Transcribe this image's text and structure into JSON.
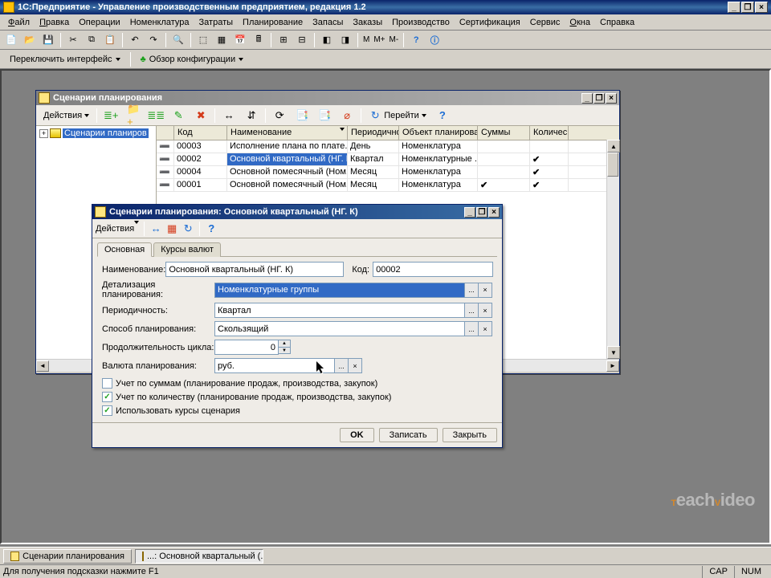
{
  "app": {
    "title": "1С:Предприятие - Управление производственным предприятием, редакция 1.2",
    "menus": [
      "Файл",
      "Правка",
      "Операции",
      "Номенклатура",
      "Затраты",
      "Планирование",
      "Запасы",
      "Заказы",
      "Производство",
      "Сертификация",
      "Сервис",
      "Окна",
      "Справка"
    ],
    "switch_interface": "Переключить интерфейс",
    "config_overview": "Обзор конфигурации"
  },
  "list_window": {
    "title": "Сценарии планирования",
    "actions": "Действия",
    "goto": "Перейти",
    "tree_root": "Сценарии планиров",
    "columns": [
      "",
      "Код",
      "Наименование",
      "Периодично..",
      "Объект планирова..",
      "Суммы",
      "Количес.."
    ],
    "rows": [
      {
        "code": "00003",
        "name": "Исполнение плана по плате..",
        "period": "День",
        "object": "Номенклатура",
        "sum": false,
        "qty": false
      },
      {
        "code": "00002",
        "name": "Основной квартальный (НГ. К)",
        "period": "Квартал",
        "object": "Номенклатурные ..",
        "sum": false,
        "qty": true
      },
      {
        "code": "00004",
        "name": "Основной помесячный (Ном..",
        "period": "Месяц",
        "object": "Номенклатура",
        "sum": false,
        "qty": true
      },
      {
        "code": "00001",
        "name": "Основной помесячный (Ном..",
        "period": "Месяц",
        "object": "Номенклатура",
        "sum": true,
        "qty": true
      }
    ]
  },
  "dialog": {
    "title": "Сценарии планирования: Основной квартальный (НГ. К)",
    "actions": "Действия",
    "tab_main": "Основная",
    "tab_rates": "Курсы валют",
    "fields": {
      "name_label": "Наименование:",
      "name_value": "Основной квартальный (НГ. К)",
      "code_label": "Код:",
      "code_value": "00002",
      "detail_label": "Детализация планирования:",
      "detail_value": "Номенклатурные группы",
      "period_label": "Периодичность:",
      "period_value": "Квартал",
      "method_label": "Способ планирования:",
      "method_value": "Скользящий",
      "cycle_label": "Продолжительность цикла:",
      "cycle_value": "0",
      "currency_label": "Валюта планирования:",
      "currency_value": "руб."
    },
    "checks": {
      "by_sum": "Учет по суммам (планирование продаж, производства, закупок)",
      "by_qty": "Учет по количеству (планирование продаж, производства, закупок)",
      "use_rates": "Использовать курсы сценария"
    },
    "buttons": {
      "ok": "OK",
      "write": "Записать",
      "close": "Закрыть"
    }
  },
  "taskbar": {
    "item1": "Сценарии планирования",
    "item2": "...: Основной квартальный (..."
  },
  "statusbar": {
    "hint": "Для получения подсказки нажмите F1",
    "cap": "CAP",
    "num": "NUM"
  }
}
